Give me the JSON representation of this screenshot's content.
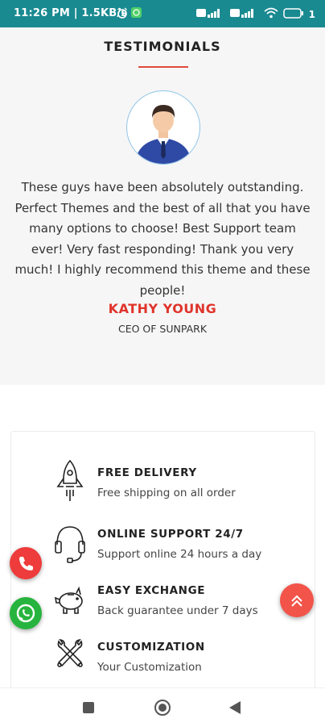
{
  "status_bar": {
    "time": "11:26 PM | 1.5KB/s",
    "battery": "1"
  },
  "testimonials": {
    "title": "TESTIMONIALS",
    "quote": "These guys have been absolutely outstanding. Perfect Themes and the best of all that you have many options to choose! Best Support team ever! Very fast responding! Thank you very much! I highly recommend this theme and these people!",
    "author": "KATHY YOUNG",
    "role": "CEO OF SUNPARK"
  },
  "features": [
    {
      "icon": "rocket-icon",
      "title": "FREE DELIVERY",
      "desc": "Free shipping on all order"
    },
    {
      "icon": "headset-icon",
      "title": "ONLINE SUPPORT 24/7",
      "desc": "Support online 24 hours a day"
    },
    {
      "icon": "piggy-bank-icon",
      "title": "EASY EXCHANGE",
      "desc": "Back guarantee under 7 days"
    },
    {
      "icon": "tools-icon",
      "title": "CUSTOMIZATION",
      "desc": "Your Customization"
    }
  ],
  "colors": {
    "status_bar": "#1a8a91",
    "accent_red": "#e0342b",
    "whatsapp_green": "#27b43e"
  }
}
